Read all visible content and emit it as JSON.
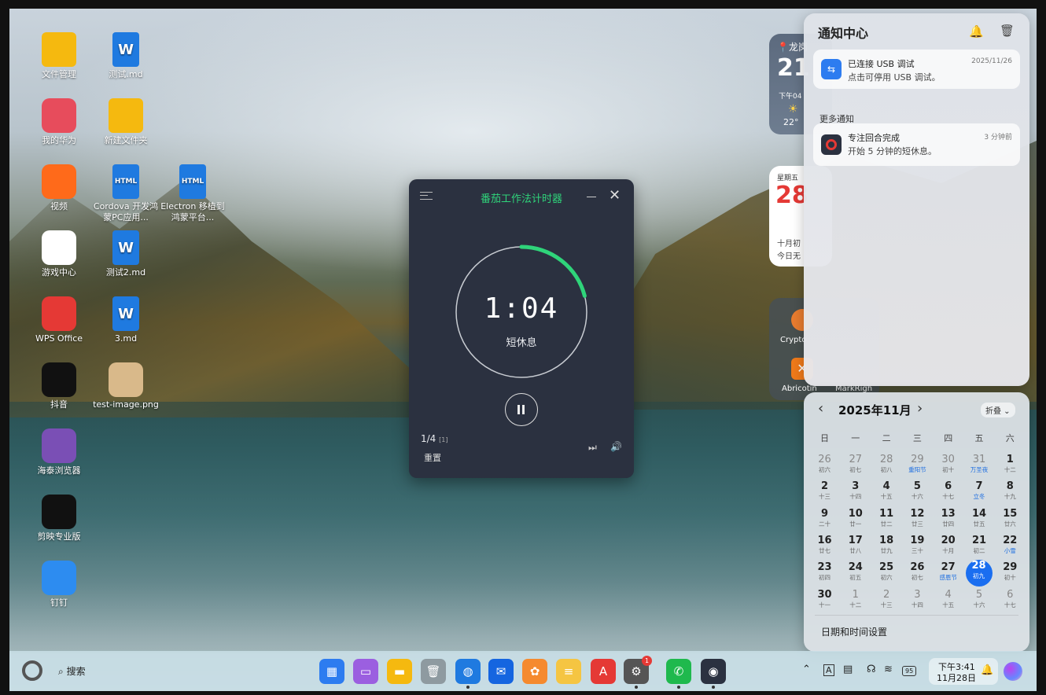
{
  "desktop": {
    "icons": [
      {
        "label": "文件管理",
        "name": "desktop-icon-file-manager",
        "icon": "folder-icon",
        "color": "#f5b90f"
      },
      {
        "label": "测试.md",
        "name": "desktop-icon-test-md",
        "icon": "word-doc-icon",
        "color": "#1f7ae0"
      },
      {
        "label": "我的华为",
        "name": "desktop-icon-my-huawei",
        "icon": "huawei-icon",
        "color": "#e74c5c"
      },
      {
        "label": "新建文件夹",
        "name": "desktop-icon-new-folder",
        "icon": "folder-icon",
        "color": "#f5b90f"
      },
      {
        "label": "视频",
        "name": "desktop-icon-video",
        "icon": "video-icon",
        "color": "#ff6a1a"
      },
      {
        "label": "Cordova 开发鸿蒙PC应用...",
        "name": "desktop-icon-cordova-html",
        "icon": "html-doc-icon",
        "color": "#1f7ae0"
      },
      {
        "label": "Electron 移植到鸿蒙平台...",
        "name": "desktop-icon-electron-html",
        "icon": "html-doc-icon",
        "color": "#1f7ae0"
      },
      {
        "label": "游戏中心",
        "name": "desktop-icon-game-center",
        "icon": "gamepad-icon",
        "color": "#ffffff"
      },
      {
        "label": "测试2.md",
        "name": "desktop-icon-test2-md",
        "icon": "word-doc-icon",
        "color": "#1f7ae0"
      },
      {
        "label": "WPS Office",
        "name": "desktop-icon-wps",
        "icon": "wps-icon",
        "color": "#e53935"
      },
      {
        "label": "3.md",
        "name": "desktop-icon-3-md",
        "icon": "word-doc-icon",
        "color": "#1f7ae0"
      },
      {
        "label": "抖音",
        "name": "desktop-icon-douyin",
        "icon": "douyin-icon",
        "color": "#111111"
      },
      {
        "label": "test-image.png",
        "name": "desktop-icon-test-image",
        "icon": "image-thumbnail-icon",
        "color": "#d9b98a"
      },
      {
        "label": "海泰浏览器",
        "name": "desktop-icon-browser",
        "icon": "browser-icon",
        "color": "#7a4fb5"
      },
      {
        "label": "剪映专业版",
        "name": "desktop-icon-capcut",
        "icon": "capcut-icon",
        "color": "#111111"
      },
      {
        "label": "钉钉",
        "name": "desktop-icon-dingtalk",
        "icon": "dingtalk-icon",
        "color": "#2d8cf0"
      }
    ],
    "icon_glyphs": {
      "W": "W",
      "HTML": "HTML"
    }
  },
  "pomodoro": {
    "title": "番茄工作法计时器",
    "time": "1:04",
    "phase": "短休息",
    "progress": 0.21,
    "round": "1/4",
    "round_sub": "[1]",
    "reset": "重置",
    "accent": "#2fd47a"
  },
  "widgets": {
    "weather": {
      "location": "龙岗",
      "temp": "21",
      "time": "下午04",
      "low": "22°"
    },
    "calendar_widget": {
      "weekday": "星期五",
      "day": "28",
      "lunar": "十月初",
      "note": "今日无"
    },
    "apps": {
      "app1": "Crypto",
      "app2": "Abricotin",
      "app3": "MarkRigh"
    }
  },
  "notification_center": {
    "title": "通知中心",
    "usb": {
      "title": "已连接 USB 调试",
      "body": "点击可停用 USB 调试。",
      "time": "2025/11/26"
    },
    "more_label": "更多通知",
    "focus": {
      "title": "专注回合完成",
      "body": "开始 5 分钟的短休息。",
      "time": "3 分钟前"
    }
  },
  "calendar": {
    "month_title": "2025年11月",
    "fold_label": "折叠",
    "weekdays": [
      "日",
      "一",
      "二",
      "三",
      "四",
      "五",
      "六"
    ],
    "weeks": [
      [
        [
          "26",
          "初六",
          1,
          0
        ],
        [
          "27",
          "初七",
          1,
          0
        ],
        [
          "28",
          "初八",
          1,
          0
        ],
        [
          "29",
          "重阳节",
          1,
          1
        ],
        [
          "30",
          "初十",
          1,
          0
        ],
        [
          "31",
          "万圣夜",
          1,
          1
        ],
        [
          "1",
          "十二",
          0,
          0
        ]
      ],
      [
        [
          "2",
          "十三",
          0,
          0
        ],
        [
          "3",
          "十四",
          0,
          0
        ],
        [
          "4",
          "十五",
          0,
          0
        ],
        [
          "5",
          "十六",
          0,
          0
        ],
        [
          "6",
          "十七",
          0,
          0
        ],
        [
          "7",
          "立冬",
          0,
          1
        ],
        [
          "8",
          "十九",
          0,
          0
        ]
      ],
      [
        [
          "9",
          "二十",
          0,
          0
        ],
        [
          "10",
          "廿一",
          0,
          0
        ],
        [
          "11",
          "廿二",
          0,
          0
        ],
        [
          "12",
          "廿三",
          0,
          0
        ],
        [
          "13",
          "廿四",
          0,
          0
        ],
        [
          "14",
          "廿五",
          0,
          0
        ],
        [
          "15",
          "廿六",
          0,
          0
        ]
      ],
      [
        [
          "16",
          "廿七",
          0,
          0
        ],
        [
          "17",
          "廿八",
          0,
          0
        ],
        [
          "18",
          "廿九",
          0,
          0
        ],
        [
          "19",
          "三十",
          0,
          0
        ],
        [
          "20",
          "十月",
          0,
          0
        ],
        [
          "21",
          "初二",
          0,
          0
        ],
        [
          "22",
          "小雪",
          0,
          1
        ]
      ],
      [
        [
          "23",
          "初四",
          0,
          0
        ],
        [
          "24",
          "初五",
          0,
          0
        ],
        [
          "25",
          "初六",
          0,
          0
        ],
        [
          "26",
          "初七",
          0,
          0
        ],
        [
          "27",
          "感恩节",
          0,
          1
        ],
        [
          "28",
          "初九",
          0,
          2
        ],
        [
          "29",
          "初十",
          0,
          0
        ]
      ],
      [
        [
          "30",
          "十一",
          0,
          0
        ],
        [
          "1",
          "十二",
          1,
          0
        ],
        [
          "2",
          "十三",
          1,
          0
        ],
        [
          "3",
          "十四",
          1,
          0
        ],
        [
          "4",
          "十五",
          1,
          0
        ],
        [
          "5",
          "十六",
          1,
          0
        ],
        [
          "6",
          "十七",
          1,
          0
        ]
      ]
    ],
    "settings_label": "日期和时间设置"
  },
  "taskbar": {
    "search_label": "搜索",
    "apps": [
      {
        "name": "taskbar-app-launcher",
        "icon": "grid-icon",
        "color": "#2d7cf0",
        "glyph": "▦"
      },
      {
        "name": "taskbar-multitask",
        "icon": "window-icon",
        "color": "#9b5fe0",
        "glyph": "▭"
      },
      {
        "name": "taskbar-files",
        "icon": "folder-icon",
        "color": "#f5b90f",
        "glyph": "▬"
      },
      {
        "name": "taskbar-trash",
        "icon": "trash-icon",
        "color": "#8e9aa0",
        "glyph": "🗑"
      },
      {
        "name": "taskbar-browser",
        "icon": "globe-icon",
        "color": "#1f7ae0",
        "glyph": "◍"
      },
      {
        "name": "taskbar-mail",
        "icon": "mail-icon",
        "color": "#1565e0",
        "glyph": "✉"
      },
      {
        "name": "taskbar-photos",
        "icon": "photos-icon",
        "color": "#f58a2f",
        "glyph": "✿"
      },
      {
        "name": "taskbar-notes",
        "icon": "notes-icon",
        "color": "#f5c542",
        "glyph": "≡"
      },
      {
        "name": "taskbar-appgallery",
        "icon": "appgallery-icon",
        "color": "#e53935",
        "glyph": "A"
      },
      {
        "name": "taskbar-settings",
        "icon": "settings-icon",
        "color": "#555555",
        "glyph": "⚙"
      },
      {
        "name": "taskbar-wechat",
        "icon": "wechat-icon",
        "color": "#1fb94d",
        "glyph": "✆"
      },
      {
        "name": "taskbar-pomodoro",
        "icon": "pomodoro-icon",
        "color": "#2b3140",
        "glyph": "◉"
      }
    ],
    "settings_badge": "1",
    "clock_time": "下午3:41",
    "clock_date": "11月28日",
    "battery": "95"
  }
}
